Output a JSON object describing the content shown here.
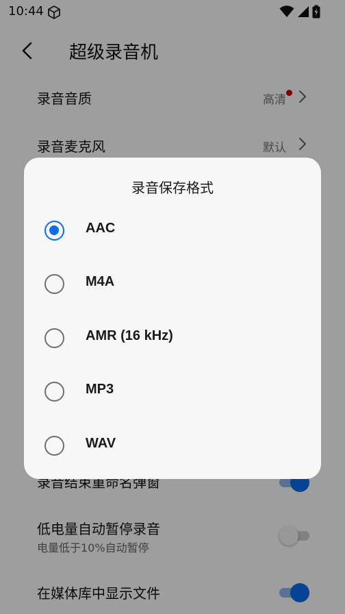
{
  "status_bar": {
    "time": "10:44"
  },
  "app_bar": {
    "title": "超级录音机"
  },
  "settings": {
    "quality": {
      "label": "录音音质",
      "value": "高清",
      "has_red_dot": true
    },
    "microphone": {
      "label": "录音麦克风",
      "value": "默认"
    },
    "naming_popup": {
      "label": "录音结束重命名弹窗",
      "enabled": true
    },
    "low_battery_pause": {
      "label": "低电量自动暂停录音",
      "sub": "电量低于10%自动暂停",
      "enabled": false
    },
    "show_in_media": {
      "label": "在媒体库中显示文件",
      "enabled": true
    }
  },
  "dialog": {
    "title": "录音保存格式",
    "options": [
      {
        "label": "AAC",
        "selected": true
      },
      {
        "label": "M4A",
        "selected": false
      },
      {
        "label": "AMR (16 kHz)",
        "selected": false
      },
      {
        "label": "MP3",
        "selected": false
      },
      {
        "label": "WAV",
        "selected": false
      }
    ]
  },
  "colors": {
    "accent": "#0a6cf0",
    "red_dot": "#d00000"
  }
}
